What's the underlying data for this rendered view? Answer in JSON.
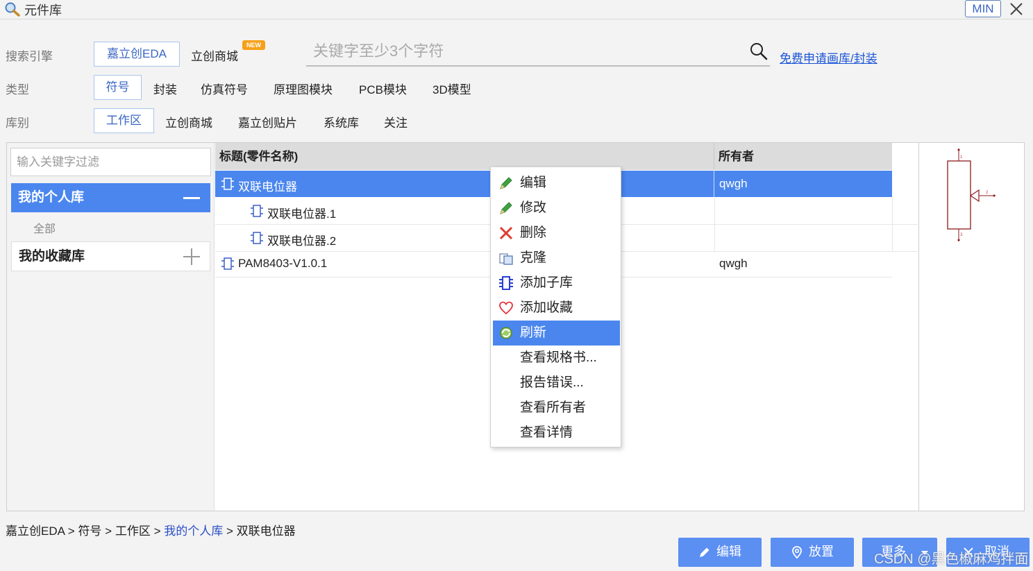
{
  "window": {
    "title": "元件库",
    "min_label": "MIN"
  },
  "search_engine": {
    "label": "搜索引擎",
    "options": [
      "嘉立创EDA",
      "立创商城"
    ],
    "badge": "NEW",
    "search_placeholder": "关键字至少3个字符",
    "apply_link": "免费申请画库/封装"
  },
  "type": {
    "label": "类型",
    "options": [
      "符号",
      "封装",
      "仿真符号",
      "原理图模块",
      "PCB模块",
      "3D模型"
    ]
  },
  "library": {
    "label": "库别",
    "options": [
      "工作区",
      "立创商城",
      "嘉立创贴片",
      "系统库",
      "关注"
    ]
  },
  "sidebar": {
    "filter_placeholder": "输入关键字过滤",
    "my_library": "我的个人库",
    "all": "全部",
    "favorites": "我的收藏库"
  },
  "table": {
    "headers": [
      "标题(零件名称)",
      "所有者"
    ],
    "rows": [
      {
        "name": "双联电位器",
        "owner": "qwgh"
      },
      {
        "name": "双联电位器.1",
        "owner": ""
      },
      {
        "name": "双联电位器.2",
        "owner": ""
      },
      {
        "name": "PAM8403-V1.0.1",
        "owner": "qwgh"
      }
    ]
  },
  "preview": {
    "pin_labels": [
      "1",
      "2",
      "3"
    ]
  },
  "context_menu": {
    "items": [
      "编辑",
      "修改",
      "删除",
      "克隆",
      "添加子库",
      "添加收藏",
      "刷新",
      "查看规格书...",
      "报告错误...",
      "查看所有者",
      "查看详情"
    ],
    "active_index": 6
  },
  "breadcrumb": {
    "parts": [
      "嘉立创EDA",
      "符号",
      "工作区",
      "我的个人库",
      "双联电位器"
    ],
    "separator": ">"
  },
  "buttons": {
    "edit": "编辑",
    "place": "放置",
    "more": "更多",
    "cancel": "取消"
  },
  "watermark": "CSDN @黑色椒麻鸡拌面",
  "colors": {
    "accent": "#4a86ee",
    "button": "#5b8ff2",
    "link": "#1a55d6",
    "badge": "#f6a11a"
  }
}
